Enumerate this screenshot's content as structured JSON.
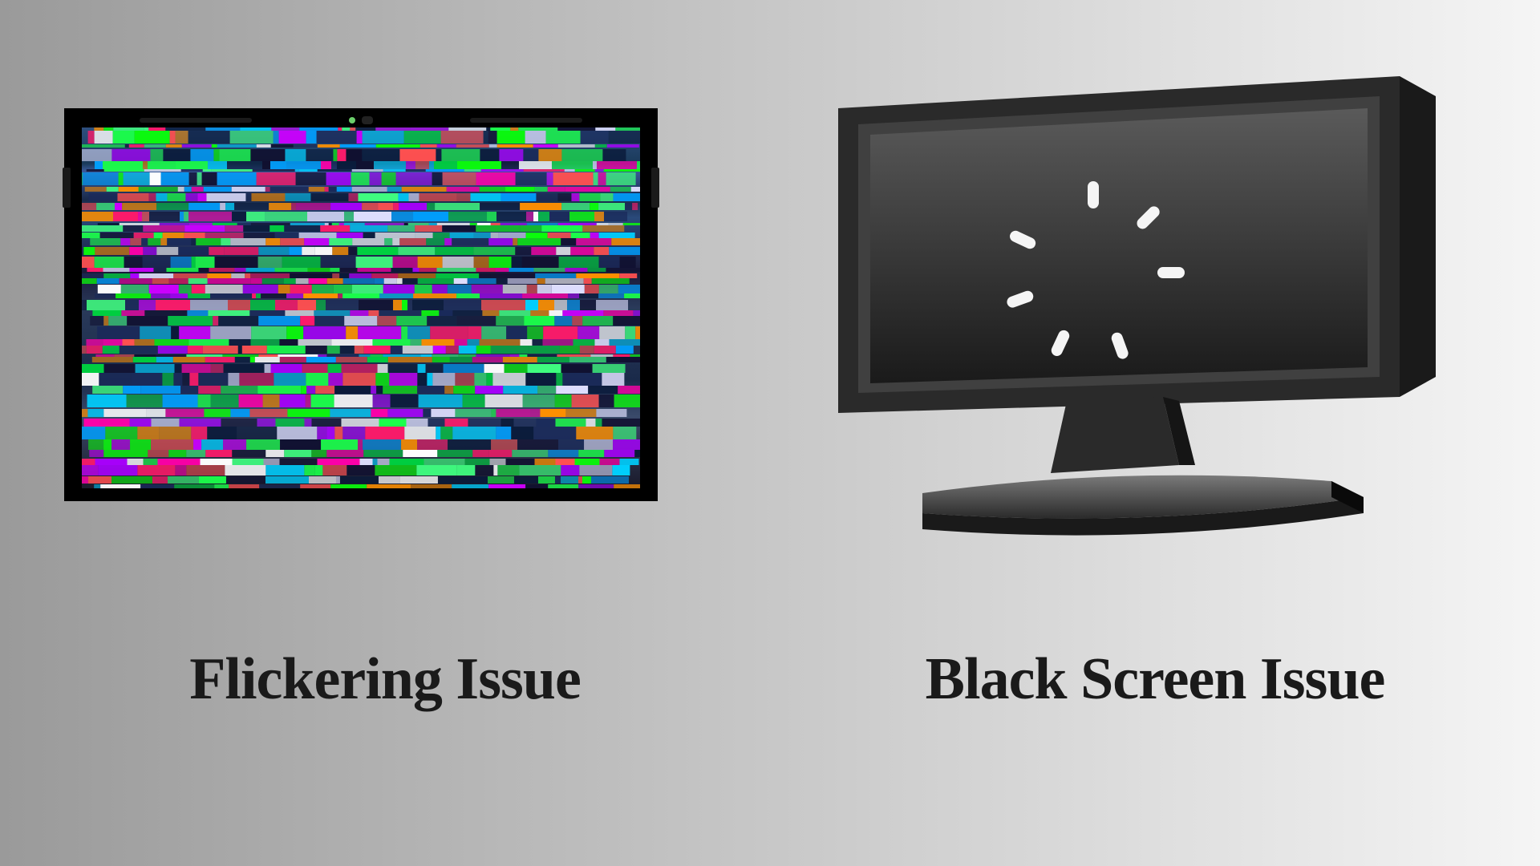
{
  "left": {
    "caption": "Flickering Issue"
  },
  "right": {
    "caption": "Black Screen Issue"
  }
}
